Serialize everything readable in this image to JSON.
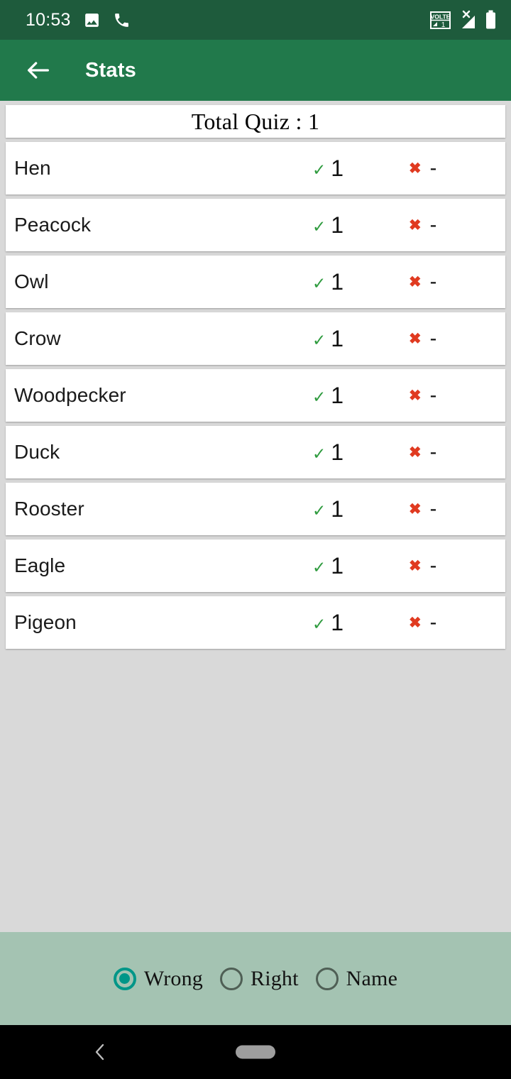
{
  "status_bar": {
    "time": "10:53",
    "icons": [
      "image-icon",
      "phone-icon",
      "volte-icon",
      "signal-no-service-icon",
      "battery-icon"
    ],
    "volte_label": "VOLTE",
    "sim_slot": "1",
    "background_color": "#1e5b3c"
  },
  "app_bar": {
    "back_icon": "back-arrow-icon",
    "title": "Stats",
    "background_color": "#21794b"
  },
  "list": {
    "header": "Total Quiz : 1",
    "check_icon": "check-icon",
    "cross_icon": "cross-icon",
    "check_color": "#2e9b3e",
    "cross_color": "#e03a20",
    "rows": [
      {
        "name": "Hen",
        "right": "1",
        "wrong": "-"
      },
      {
        "name": "Peacock",
        "right": "1",
        "wrong": "-"
      },
      {
        "name": "Owl",
        "right": "1",
        "wrong": "-"
      },
      {
        "name": "Crow",
        "right": "1",
        "wrong": "-"
      },
      {
        "name": "Woodpecker",
        "right": "1",
        "wrong": "-"
      },
      {
        "name": "Duck",
        "right": "1",
        "wrong": "-"
      },
      {
        "name": "Rooster",
        "right": "1",
        "wrong": "-"
      },
      {
        "name": "Eagle",
        "right": "1",
        "wrong": "-"
      },
      {
        "name": "Pigeon",
        "right": "1",
        "wrong": "-"
      }
    ]
  },
  "filter_bar": {
    "background_color": "#a4c3b2",
    "selected_color": "#009688",
    "options": [
      {
        "label": "Wrong",
        "selected": true
      },
      {
        "label": "Right",
        "selected": false
      },
      {
        "label": "Name",
        "selected": false
      }
    ]
  },
  "nav_bar": {
    "back_icon": "nav-back-chevron-icon",
    "home_pill": "nav-home-pill"
  }
}
